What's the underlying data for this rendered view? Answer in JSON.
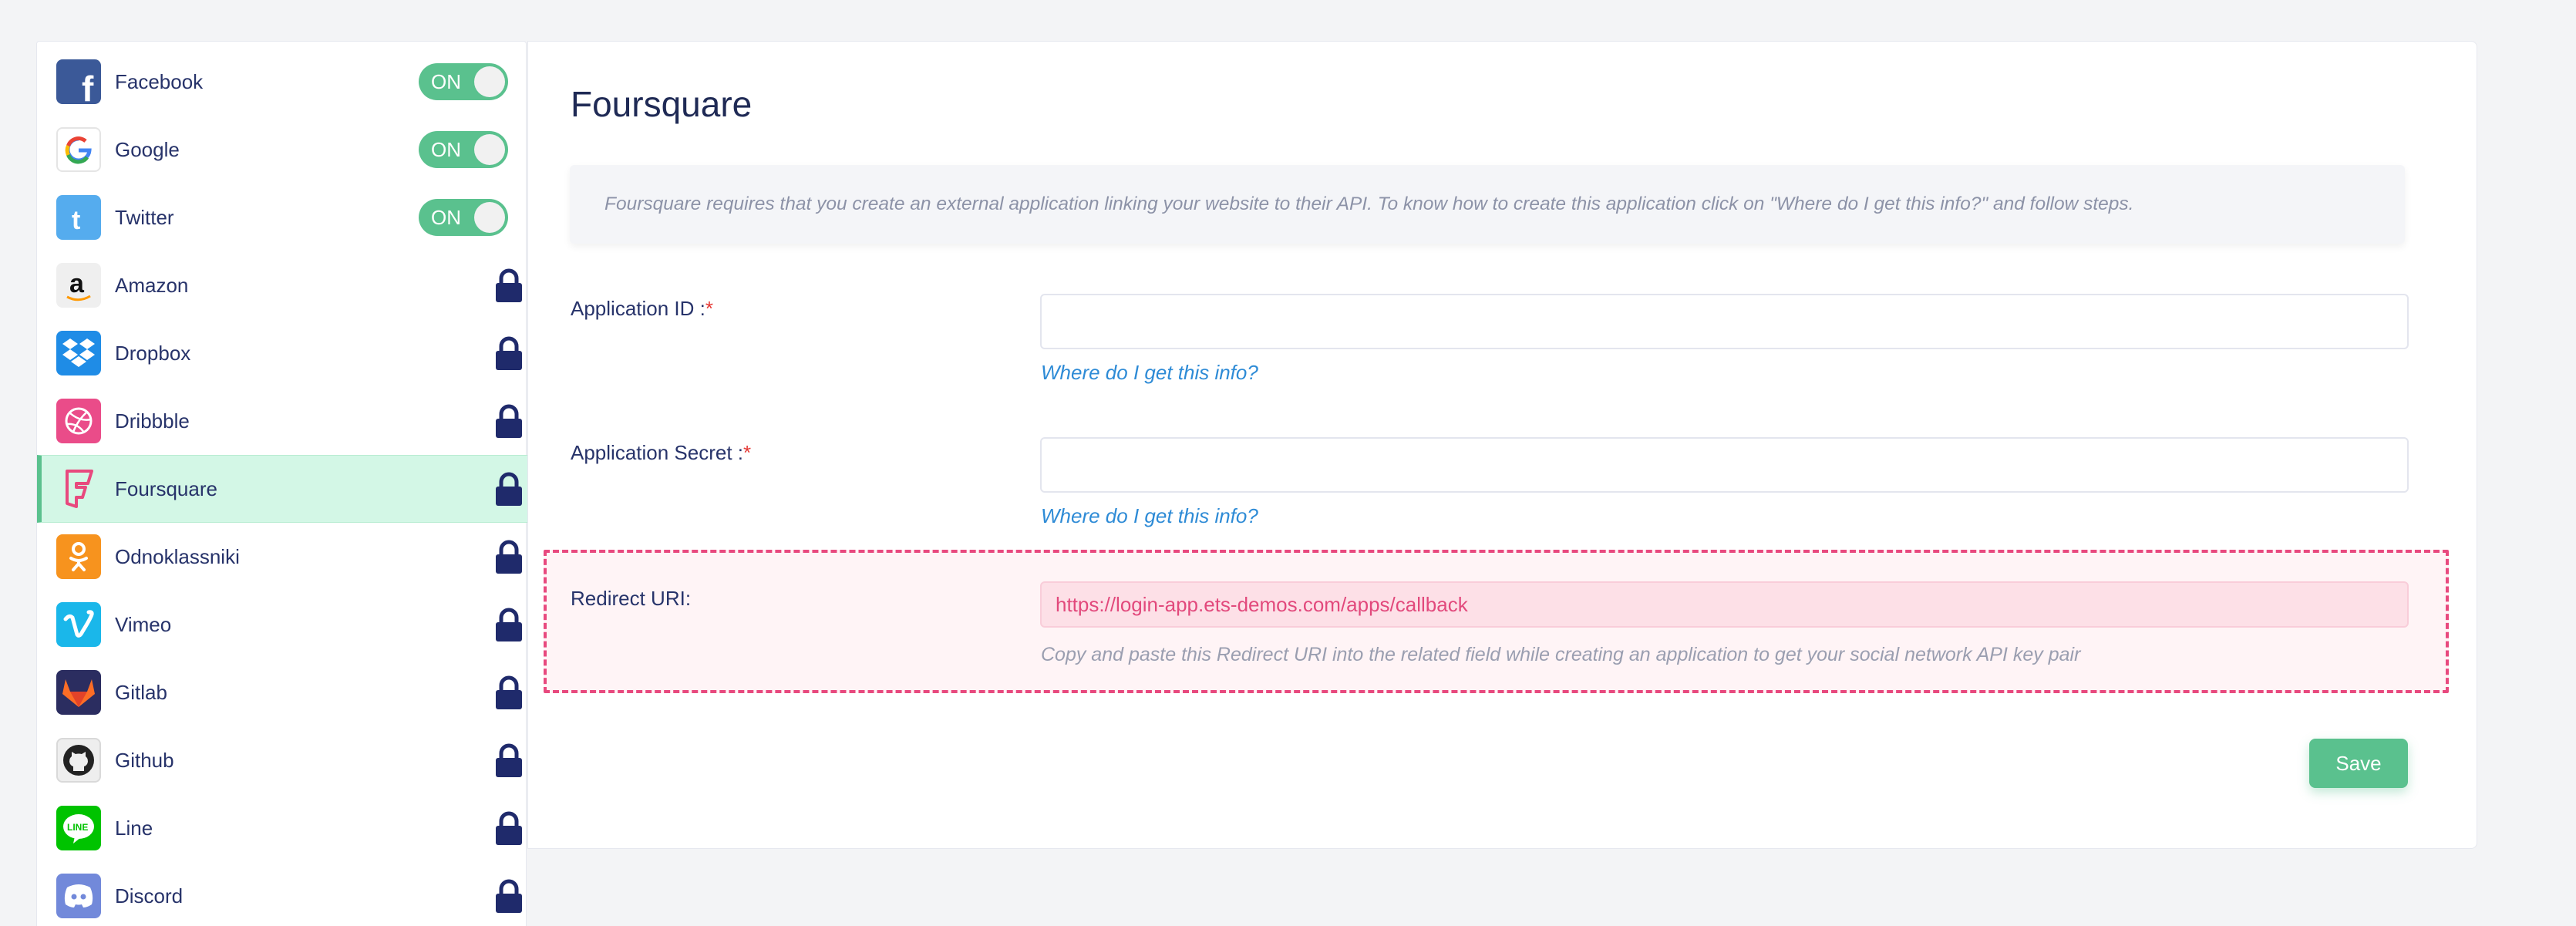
{
  "sidebar": {
    "items": [
      {
        "label": "Facebook",
        "state": "on",
        "toggle_label": "ON",
        "icon": "facebook-icon",
        "color": "#3b5998"
      },
      {
        "label": "Google",
        "state": "on",
        "toggle_label": "ON",
        "icon": "google-icon",
        "color": "#ffffff"
      },
      {
        "label": "Twitter",
        "state": "on",
        "toggle_label": "ON",
        "icon": "twitter-icon",
        "color": "#55acee"
      },
      {
        "label": "Amazon",
        "state": "locked",
        "icon": "amazon-icon",
        "color": "#eeeeee"
      },
      {
        "label": "Dropbox",
        "state": "locked",
        "icon": "dropbox-icon",
        "color": "#1f8ce6"
      },
      {
        "label": "Dribbble",
        "state": "locked",
        "icon": "dribbble-icon",
        "color": "#ea4c89"
      },
      {
        "label": "Foursquare",
        "state": "locked",
        "icon": "foursquare-icon",
        "color": "#f2f2f2",
        "active": true
      },
      {
        "label": "Odnoklassniki",
        "state": "locked",
        "icon": "odnoklassniki-icon",
        "color": "#f7931e"
      },
      {
        "label": "Vimeo",
        "state": "locked",
        "icon": "vimeo-icon",
        "color": "#1ab7ea"
      },
      {
        "label": "Gitlab",
        "state": "locked",
        "icon": "gitlab-icon",
        "color": "#2b2d60"
      },
      {
        "label": "Github",
        "state": "locked",
        "icon": "github-icon",
        "color": "#eeeeee"
      },
      {
        "label": "Line",
        "state": "locked",
        "icon": "line-icon",
        "color": "#00c300"
      },
      {
        "label": "Discord",
        "state": "locked",
        "icon": "discord-icon",
        "color": "#7289da"
      }
    ]
  },
  "main": {
    "title": "Foursquare",
    "info": "Foursquare requires that you create an external application linking your website to their API. To know how to create this application click on \"Where do I get this info?\" and follow steps.",
    "fields": [
      {
        "label": "Application ID :",
        "required_mark": "*",
        "value": "",
        "help": "Where do I get this info?"
      },
      {
        "label": "Application Secret :",
        "required_mark": "*",
        "value": "",
        "help": "Where do I get this info?"
      }
    ],
    "redirect": {
      "label": "Redirect URI:",
      "value": "https://login-app.ets-demos.com/apps/callback",
      "help": "Copy and paste this Redirect URI into the related field while creating an application to get your social network API key pair"
    },
    "save_label": "Save"
  },
  "colors": {
    "accent": "#5ac18e",
    "active_bg": "#d3f7e6",
    "lock": "#1f2a6b",
    "highlight_border": "#e8497e",
    "link": "#2e8bd6"
  }
}
